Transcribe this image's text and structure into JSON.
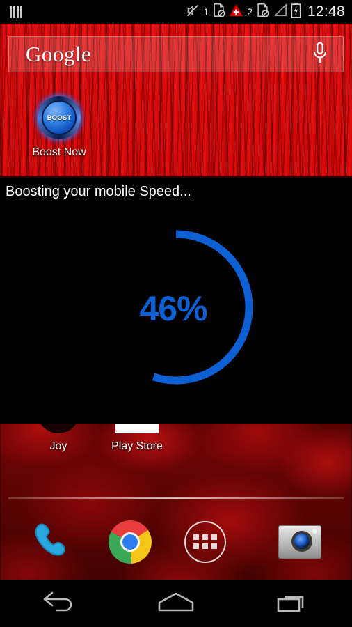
{
  "statusbar": {
    "notification_icon": "equalizer-bars-icon",
    "icons": [
      {
        "name": "ringer-muted-icon",
        "label": ""
      },
      {
        "name": "sim1-no-service-icon",
        "label": "1"
      },
      {
        "name": "alert-triangle-icon",
        "label": ""
      },
      {
        "name": "sim2-no-service-icon",
        "label": "2"
      },
      {
        "name": "signal-empty-icon",
        "label": ""
      },
      {
        "name": "battery-charging-icon",
        "label": ""
      }
    ],
    "sim1_number": "1",
    "sim2_number": "2",
    "clock": "12:48"
  },
  "search_widget": {
    "brand": "Google",
    "mic_icon": "microphone-icon"
  },
  "home": {
    "apps": [
      {
        "label": "Boost Now",
        "icon": "boost-button-icon",
        "badge_text": "BOOST"
      },
      {
        "label": "Joy",
        "icon": "mail-envelope-icon"
      },
      {
        "label": "Play Store",
        "icon": "play-store-icon"
      }
    ],
    "boost_app_label": "Boost Now",
    "joy_label": "Joy",
    "play_store_label": "Play Store",
    "boost_badge": "BOOST"
  },
  "boost_overlay": {
    "title": "Boosting your mobile Speed...",
    "percent_label": "46%",
    "percent_value": 46,
    "accent_color": "#0d5fd4",
    "track_color": "#000000",
    "background": "#000000",
    "arc_start_deg": 0,
    "arc_sweep_deg": 198
  },
  "dock": {
    "items": [
      {
        "name": "phone-icon",
        "label": "Phone"
      },
      {
        "name": "chrome-icon",
        "label": "Chrome"
      },
      {
        "name": "app-drawer-icon",
        "label": "Apps"
      },
      {
        "name": "camera-icon",
        "label": "Camera"
      }
    ]
  },
  "navbar": {
    "buttons": [
      {
        "name": "back-button",
        "icon": "back-arrow-icon"
      },
      {
        "name": "home-button",
        "icon": "home-icon"
      },
      {
        "name": "recents-button",
        "icon": "recents-icon"
      }
    ]
  },
  "wallpaper": {
    "top_color": "#d40707",
    "bottom_color": "#5a0303"
  }
}
